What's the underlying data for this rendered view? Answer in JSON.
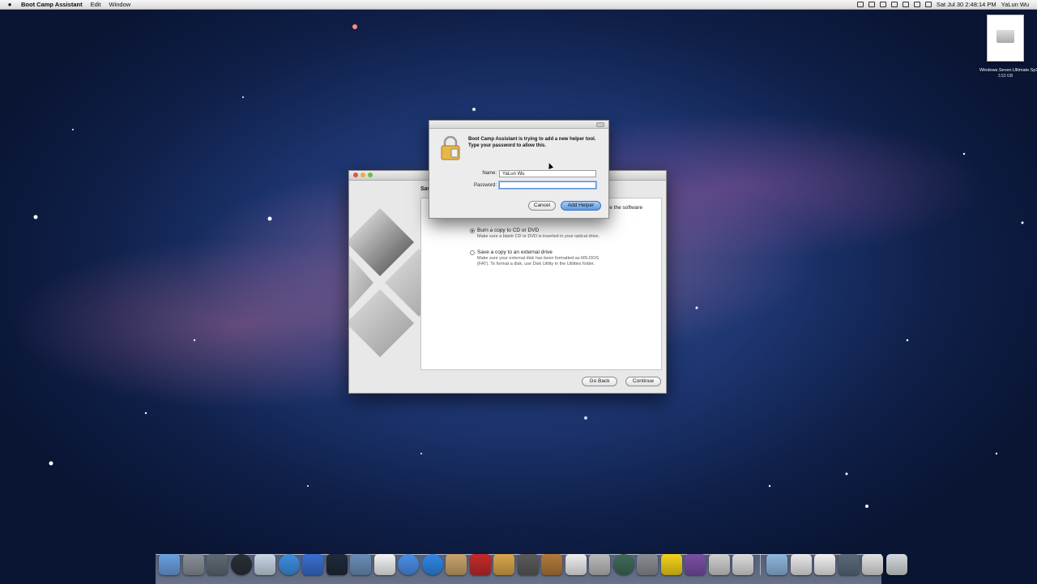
{
  "menubar": {
    "app_name": "Boot Camp Assistant",
    "menus": [
      "Edit",
      "Window"
    ],
    "clock": "Sat Jul 30  2:48:14 PM",
    "user": "YaLun Wu",
    "status_icons": [
      "screen-icon",
      "display-icon",
      "bluetooth-icon",
      "time-machine-icon",
      "wifi-icon",
      "volume-icon",
      "flag-icon"
    ]
  },
  "desktop_file": {
    "name": "Windows.Seven.Ultimate.Sp1.32bit...Ne8rAl.iso",
    "size": "3.53 GB"
  },
  "main_window": {
    "heading_fragment": "Sav",
    "bleed_text": "ve the software",
    "options": [
      {
        "label": "Burn a copy to CD or DVD",
        "desc": "Make sure a blank CD or DVD is inserted in your optical drive.",
        "selected": true
      },
      {
        "label": "Save a copy to an external drive",
        "desc": "Make sure your external disk has been formatted as MS-DOS (FAT).  To format a disk, use Disk Utility in the Utilities folder.",
        "selected": false
      }
    ],
    "go_back_label": "Go Back",
    "continue_label": "Continue"
  },
  "auth_dialog": {
    "message": "Boot Camp Assistant is trying to add a new helper tool. Type your password to allow this.",
    "name_label": "Name:",
    "name_value": "YaLun Wu",
    "password_label": "Password:",
    "password_value": "",
    "cancel_label": "Cancel",
    "add_helper_label": "Add Helper"
  },
  "dock": {
    "icons": [
      {
        "name": "finder-icon",
        "color": "#6aa0e0"
      },
      {
        "name": "launchpad-icon",
        "color": "#8a8f98"
      },
      {
        "name": "mission-control-icon",
        "color": "#5d6a73"
      },
      {
        "name": "dashboard-icon",
        "color": "#2b2f36"
      },
      {
        "name": "mail-icon",
        "color": "#c9d6e6"
      },
      {
        "name": "safari-icon",
        "color": "#3d8fe0"
      },
      {
        "name": "facetime-icon",
        "color": "#3a6ed0"
      },
      {
        "name": "photo-booth-icon",
        "color": "#1e2a3a"
      },
      {
        "name": "preview-icon",
        "color": "#6b8fb8"
      },
      {
        "name": "ical-icon",
        "color": "#f3f3f3"
      },
      {
        "name": "itunes-icon",
        "color": "#4a8ee8"
      },
      {
        "name": "app-store-icon",
        "color": "#2f87e8"
      },
      {
        "name": "address-book-icon",
        "color": "#c7a46a"
      },
      {
        "name": "photo-icon",
        "color": "#c32a2a"
      },
      {
        "name": "iphoto-icon",
        "color": "#d9a64b"
      },
      {
        "name": "imovie-icon",
        "color": "#5a5a5a"
      },
      {
        "name": "garageband-icon",
        "color": "#b27a3a"
      },
      {
        "name": "textedit-icon",
        "color": "#eeeeee"
      },
      {
        "name": "pen-icon",
        "color": "#bbbbbb"
      },
      {
        "name": "time-machine-icon",
        "color": "#3f6a5a"
      },
      {
        "name": "system-preferences-icon",
        "color": "#8a8e93"
      },
      {
        "name": "aim-icon",
        "color": "#f2d21c"
      },
      {
        "name": "clapper-icon",
        "color": "#7b4fa6"
      },
      {
        "name": "printer-icon",
        "color": "#cfcfcf"
      },
      {
        "name": "utility-icon",
        "color": "#dcdcdc"
      },
      {
        "name": "downloads-folder-icon",
        "color": "#8fb6dc"
      },
      {
        "name": "document-icon",
        "color": "#e8e8e8"
      },
      {
        "name": "stack-icon",
        "color": "#f0f0f0"
      },
      {
        "name": "screen-share-icon",
        "color": "#5a6a7a"
      },
      {
        "name": "window-stack-icon",
        "color": "#e0e0e0"
      },
      {
        "name": "trash-icon",
        "color": "#d4d8dc"
      }
    ]
  }
}
